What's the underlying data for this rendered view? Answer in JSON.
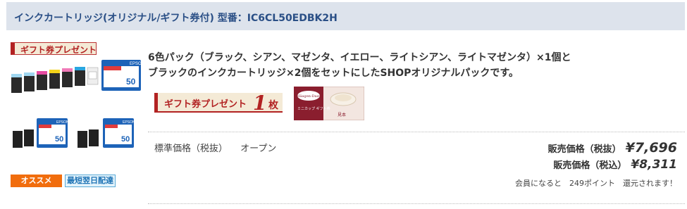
{
  "header": {
    "title": "インクカートリッジ(オリジナル/ギフト券付) 型番：IC6CL50EDBK2H"
  },
  "gift_tag": "ギフト券プレゼント",
  "badges": {
    "recommend": "オススメ",
    "next_day": "最短翌日配達"
  },
  "product": {
    "box_brand": "EPSON",
    "box_number": "50",
    "description_line1": "6色パック（ブラック、シアン、マゼンタ、イエロー、ライトシアン、ライトマゼンタ）×1個と",
    "description_line2": "ブラックのインクカートリッジ×2個をセットにしたSHOPオリジナルパックです。"
  },
  "gift_banner": {
    "text": "ギフト券プレゼント",
    "count": "1",
    "unit": "枚"
  },
  "gift_card": {
    "brand": "Häagen-Dazs",
    "caption": "ミニカップ ギフト券",
    "sample": "見本"
  },
  "pricing": {
    "standard_label": "標準価格（税抜）",
    "standard_value": "オープン",
    "sale_ex_label": "販売価格（税抜）",
    "sale_ex_value": "¥7,696",
    "sale_in_label": "販売価格（税込）",
    "sale_in_value": "¥8,311",
    "points_text": "会員になると　249ポイント　還元されます！"
  },
  "colors": {
    "header_bg": "#dde3ec",
    "header_text": "#2a4f86",
    "badge_orange": "#f16d0d",
    "badge_blue": "#1e73b5",
    "gift_red": "#b22222"
  }
}
